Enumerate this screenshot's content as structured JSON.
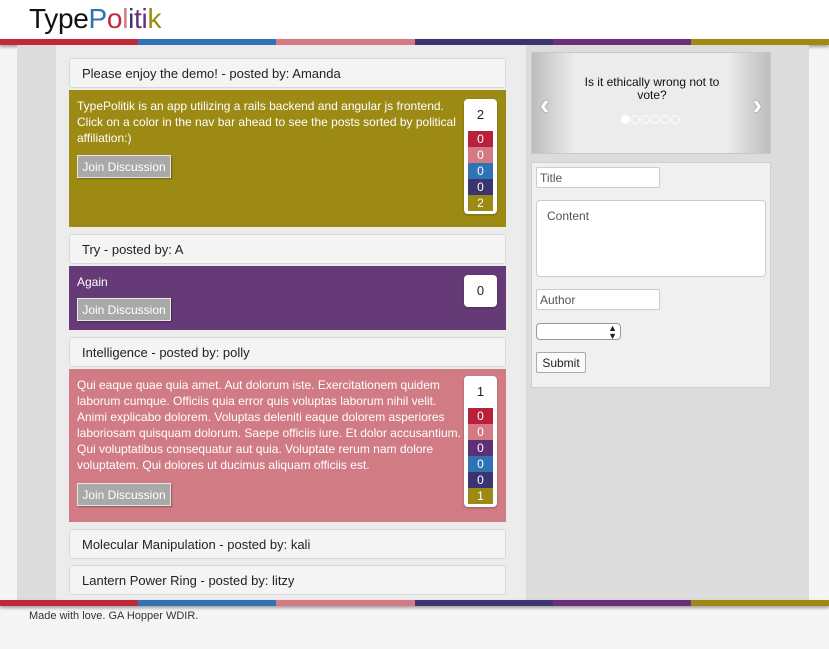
{
  "brand": {
    "parts": [
      {
        "text": "Type",
        "color": "#111111"
      },
      {
        "text": "P",
        "color": "#2f73b4"
      },
      {
        "text": "o",
        "color": "#c0293a"
      },
      {
        "text": "l",
        "color": "#d57a85"
      },
      {
        "text": "i",
        "color": "#3a3570"
      },
      {
        "text": "t",
        "color": "#6b2f7a"
      },
      {
        "text": "i",
        "color": "#6b2f7a"
      },
      {
        "text": "k",
        "color": "#9c8a15"
      }
    ]
  },
  "palette": [
    "#c0293a",
    "#2f73b4",
    "#d57a85",
    "#3a3570",
    "#6b2f7a",
    "#9c8a15"
  ],
  "vote_colors": [
    "#b8213a",
    "#d47a85",
    "#5d2f76",
    "#2f73b4",
    "#3a3570",
    "#9c8a15"
  ],
  "posts": [
    {
      "title": "Please enjoy the demo! - posted by: Amanda",
      "body": "TypePolitik is an app utilizing a rails backend and angular js frontend. Click on a color in the nav bar ahead to see the posts sorted by political affiliation:)",
      "bg": "#9c8a15",
      "join_label": "Join Discussion",
      "total": "2",
      "votes": [
        "0",
        "0",
        "0",
        "0",
        "2"
      ],
      "vote_colors": [
        "#b8213a",
        "#d47a85",
        "#2f73b4",
        "#3a3570",
        "#9c8a15"
      ]
    },
    {
      "title": "Try - posted by: A",
      "body": "Again",
      "bg": "#653a77",
      "join_label": "Join Discussion",
      "total": "0",
      "votes": [],
      "vote_colors": []
    },
    {
      "title": "Intelligence - posted by: polly",
      "body": "Qui eaque quae quia amet. Aut dolorum iste. Exercitationem quidem laborum cumque. Officiis quia error quis voluptas laborum nihil velit. Animi explicabo dolorem. Voluptas deleniti eaque dolorem asperiores laboriosam quisquam dolorum. Saepe officiis iure. Et dolor accusantium. Qui voluptatibus consequatur aut quia. Voluptate rerum nam dolore voluptatem. Qui dolores ut ducimus aliquam officiis est.",
      "bg": "#d17b84",
      "join_label": "Join Discussion",
      "total": "1",
      "votes": [
        "0",
        "0",
        "0",
        "0",
        "0",
        "1"
      ],
      "vote_colors": [
        "#b8213a",
        "#d47a85",
        "#5d2f76",
        "#2f73b4",
        "#3a3570",
        "#9c8a15"
      ]
    },
    {
      "title": "Molecular Manipulation - posted by: kali"
    },
    {
      "title": "Lantern Power Ring - posted by: litzy"
    }
  ],
  "carousel": {
    "question": "Is it ethically wrong not to vote?",
    "prev_icon": "chevron-left-icon",
    "next_icon": "chevron-right-icon",
    "dot_count": 6,
    "active_dot": 0
  },
  "form": {
    "title_placeholder": "Title",
    "content_placeholder": "Content",
    "author_placeholder": "Author",
    "select_value": "",
    "submit_label": "Submit"
  },
  "footer": {
    "text": "Made with love. GA Hopper WDIR."
  }
}
